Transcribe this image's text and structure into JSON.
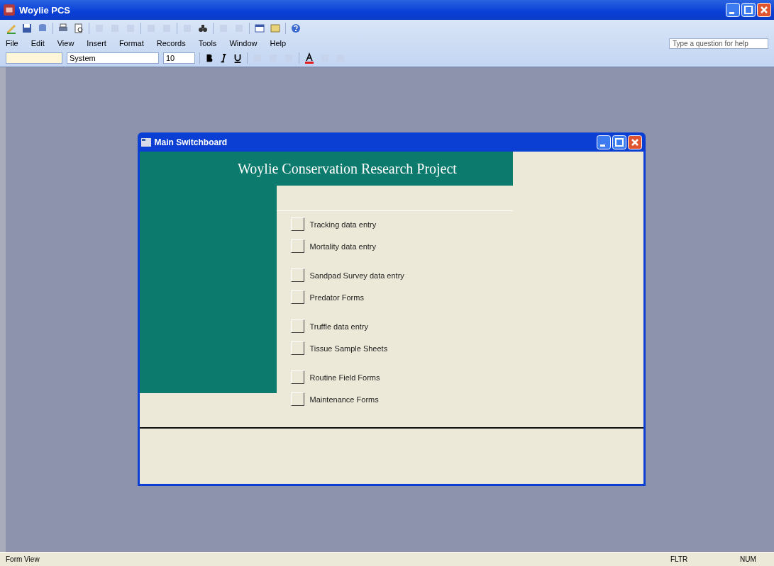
{
  "app": {
    "title": "Woylie PCS"
  },
  "menu": [
    "File",
    "Edit",
    "View",
    "Insert",
    "Format",
    "Records",
    "Tools",
    "Window",
    "Help"
  ],
  "help_box": {
    "placeholder": "Type a question for help"
  },
  "formatting": {
    "font": "System",
    "size": "10"
  },
  "form": {
    "title": "Main Switchboard",
    "heading": "Woylie Conservation Research Project",
    "groups": [
      [
        "Tracking data entry",
        "Mortality data entry"
      ],
      [
        "Sandpad Survey data entry",
        "Predator Forms"
      ],
      [
        "Truffle data entry",
        "Tissue Sample Sheets"
      ],
      [
        "Routine Field Forms",
        "Maintenance Forms"
      ]
    ]
  },
  "status_bar": [
    "Form View",
    "FLTR",
    "NUM"
  ]
}
